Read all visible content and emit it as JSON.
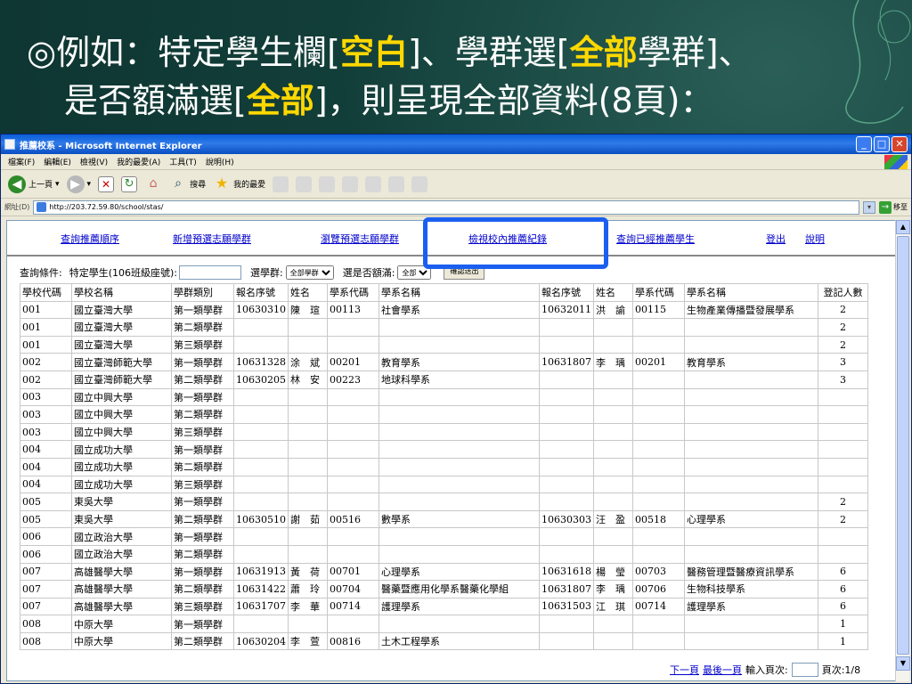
{
  "slide": {
    "bullet": "◎",
    "line1_pre": "例如：特定學生欄[",
    "line1_hl1": "空白",
    "line1_mid": "]、學群選[",
    "line1_hl2": "全部",
    "line1_post": "學群]、",
    "line2_pre": "是否額滿選[",
    "line2_hl": "全部",
    "line2_post": "]，則呈現全部資料(8頁)："
  },
  "browser": {
    "title": "推薦校系 - Microsoft Internet Explorer",
    "menus": [
      "檔案(F)",
      "編輯(E)",
      "檢視(V)",
      "我的最愛(A)",
      "工具(T)",
      "說明(H)"
    ],
    "back_label": "上一頁",
    "search_label": "搜尋",
    "favorites_label": "我的最愛",
    "address_label": "網址(D)",
    "address_value": "http://203.72.59.80/school/stas/",
    "go_label": "移至"
  },
  "nav": {
    "items": [
      "查詢推薦順序",
      "新增預選志願學群",
      "瀏覽預選志願學群",
      "檢視校內推薦紀錄",
      "查詢已經推薦學生",
      "登出",
      "說明"
    ]
  },
  "query": {
    "label": "查詢條件:",
    "student_label": "特定學生(106班級座號):",
    "group_label": "選學群:",
    "group_value": "全部學群",
    "full_label": "選是否額滿:",
    "full_value": "全部",
    "button": "確認送出"
  },
  "table": {
    "headers": [
      "學校代碼",
      "學校名稱",
      "學群類別",
      "報名序號",
      "姓名",
      "學系代碼",
      "學系名稱",
      "報名序號",
      "姓名",
      "學系代碼",
      "學系名稱",
      "登記人數"
    ],
    "rows": [
      [
        "001",
        "國立臺灣大學",
        "第一類學群",
        "10630310",
        "陳　瑄",
        "00113",
        "社會學系",
        "10632011",
        "洪　諭",
        "00115",
        "生物產業傳播暨發展學系",
        "2"
      ],
      [
        "001",
        "國立臺灣大學",
        "第二類學群",
        "",
        "",
        "",
        "",
        "",
        "",
        "",
        "",
        "2"
      ],
      [
        "001",
        "國立臺灣大學",
        "第三類學群",
        "",
        "",
        "",
        "",
        "",
        "",
        "",
        "",
        "2"
      ],
      [
        "002",
        "國立臺灣師範大學",
        "第一類學群",
        "10631328",
        "涂　斌",
        "00201",
        "教育學系",
        "10631807",
        "李　瑀",
        "00201",
        "教育學系",
        "3"
      ],
      [
        "002",
        "國立臺灣師範大學",
        "第二類學群",
        "10630205",
        "林　安",
        "00223",
        "地球科學系",
        "",
        "",
        "",
        "",
        "3"
      ],
      [
        "003",
        "國立中興大學",
        "第一類學群",
        "",
        "",
        "",
        "",
        "",
        "",
        "",
        "",
        ""
      ],
      [
        "003",
        "國立中興大學",
        "第二類學群",
        "",
        "",
        "",
        "",
        "",
        "",
        "",
        "",
        ""
      ],
      [
        "003",
        "國立中興大學",
        "第三類學群",
        "",
        "",
        "",
        "",
        "",
        "",
        "",
        "",
        ""
      ],
      [
        "004",
        "國立成功大學",
        "第一類學群",
        "",
        "",
        "",
        "",
        "",
        "",
        "",
        "",
        ""
      ],
      [
        "004",
        "國立成功大學",
        "第二類學群",
        "",
        "",
        "",
        "",
        "",
        "",
        "",
        "",
        ""
      ],
      [
        "004",
        "國立成功大學",
        "第三類學群",
        "",
        "",
        "",
        "",
        "",
        "",
        "",
        "",
        ""
      ],
      [
        "005",
        "東吳大學",
        "第一類學群",
        "",
        "",
        "",
        "",
        "",
        "",
        "",
        "",
        "2"
      ],
      [
        "005",
        "東吳大學",
        "第二類學群",
        "10630510",
        "謝　茹",
        "00516",
        "數學系",
        "10630303",
        "汪　盈",
        "00518",
        "心理學系",
        "2"
      ],
      [
        "006",
        "國立政治大學",
        "第一類學群",
        "",
        "",
        "",
        "",
        "",
        "",
        "",
        "",
        ""
      ],
      [
        "006",
        "國立政治大學",
        "第二類學群",
        "",
        "",
        "",
        "",
        "",
        "",
        "",
        "",
        ""
      ],
      [
        "007",
        "高雄醫學大學",
        "第一類學群",
        "10631913",
        "黃　荷",
        "00701",
        "心理學系",
        "10631618",
        "楊　瑩",
        "00703",
        "醫務管理暨醫療資訊學系",
        "6"
      ],
      [
        "007",
        "高雄醫學大學",
        "第二類學群",
        "10631422",
        "蕭　玲",
        "00704",
        "醫藥暨應用化學系醫藥化學組",
        "10631807",
        "李　瑀",
        "00706",
        "生物科技學系",
        "6"
      ],
      [
        "007",
        "高雄醫學大學",
        "第三類學群",
        "10631707",
        "李　華",
        "00714",
        "護理學系",
        "10631503",
        "江　琪",
        "00714",
        "護理學系",
        "6"
      ],
      [
        "008",
        "中原大學",
        "第一類學群",
        "",
        "",
        "",
        "",
        "",
        "",
        "",
        "",
        "1"
      ],
      [
        "008",
        "中原大學",
        "第二類學群",
        "10630204",
        "李　萱",
        "00816",
        "土木工程學系",
        "",
        "",
        "",
        "",
        "1"
      ]
    ]
  },
  "pager": {
    "next": "下一頁",
    "last": "最後一頁",
    "input_label": "輸入頁次:",
    "page_info": "頁次:1/8"
  },
  "colors": {
    "slide_bg": "#0f3a36",
    "highlight_text": "#ffd800",
    "highlight_box": "#1a5ff0",
    "link": "#0000cc"
  }
}
